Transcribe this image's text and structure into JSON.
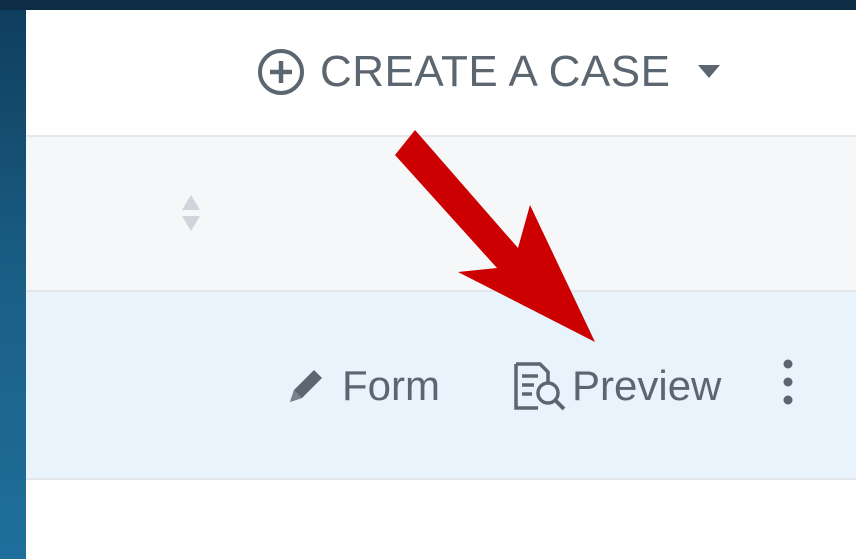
{
  "toolbar": {
    "create_label": "CREATE A CASE",
    "create_icon": "plus-circle-icon",
    "dropdown_icon": "caret-down-icon"
  },
  "header_row": {
    "sort_icon": "sort-icon"
  },
  "row": {
    "actions": [
      {
        "label": "Form",
        "icon": "pencil-icon"
      },
      {
        "label": "Preview",
        "icon": "document-search-icon"
      }
    ],
    "more_icon": "kebab-menu-icon"
  },
  "annotation": {
    "arrow_color": "#cc0000"
  },
  "colors": {
    "text": "#5c6670",
    "row_highlight": "#e8f3fc",
    "header_bg": "#f6f7f8",
    "background": "#1a5f86"
  }
}
